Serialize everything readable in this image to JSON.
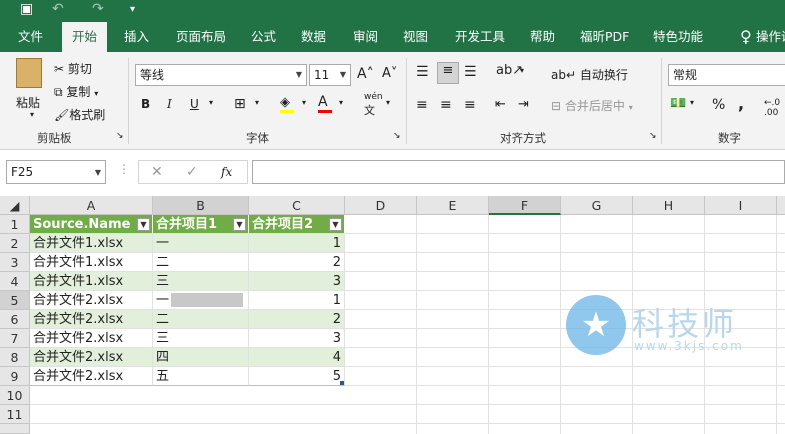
{
  "ribbon_tabs": [
    "文件",
    "开始",
    "插入",
    "页面布局",
    "公式",
    "数据",
    "审阅",
    "视图",
    "开发工具",
    "帮助",
    "福昕PDF",
    "特色功能",
    "操作说"
  ],
  "active_tab": "开始",
  "clipboard": {
    "paste": "粘贴",
    "cut": "剪切",
    "copy": "复制",
    "format_painter": "格式刷",
    "group": "剪贴板"
  },
  "font": {
    "name": "等线",
    "size": "11",
    "group": "字体",
    "bold": "B",
    "italic": "I",
    "underline": "U",
    "wen": "wén"
  },
  "alignment": {
    "wrap": "自动换行",
    "merge": "合并后居中",
    "group": "对齐方式"
  },
  "number": {
    "format": "常规",
    "percent": "%",
    "comma": ",",
    "group": "数字"
  },
  "name_box": "F25",
  "formula_icons": {
    "cancel": "✕",
    "enter": "✓",
    "fx": "fx"
  },
  "columns": [
    "A",
    "B",
    "C",
    "D",
    "E",
    "F",
    "G",
    "H",
    "I"
  ],
  "rows": [
    "1",
    "2",
    "3",
    "4",
    "5",
    "6",
    "7",
    "8",
    "9",
    "10",
    "11"
  ],
  "table": {
    "headers": [
      "Source.Name",
      "合并项目1",
      "合并项目2"
    ],
    "rows": [
      [
        "合并文件1.xlsx",
        "一",
        "1"
      ],
      [
        "合并文件1.xlsx",
        "二",
        "2"
      ],
      [
        "合并文件1.xlsx",
        "三",
        "3"
      ],
      [
        "合并文件2.xlsx",
        "一",
        "1"
      ],
      [
        "合并文件2.xlsx",
        "二",
        "2"
      ],
      [
        "合并文件2.xlsx",
        "三",
        "3"
      ],
      [
        "合并文件2.xlsx",
        "四",
        "4"
      ],
      [
        "合并文件2.xlsx",
        "五",
        "5"
      ]
    ]
  },
  "watermark": {
    "name": "科技师",
    "url": "www.3kjs.com"
  },
  "colors": {
    "excel_green": "#217346",
    "table_header": "#70ad47",
    "band": "#e2efda"
  }
}
